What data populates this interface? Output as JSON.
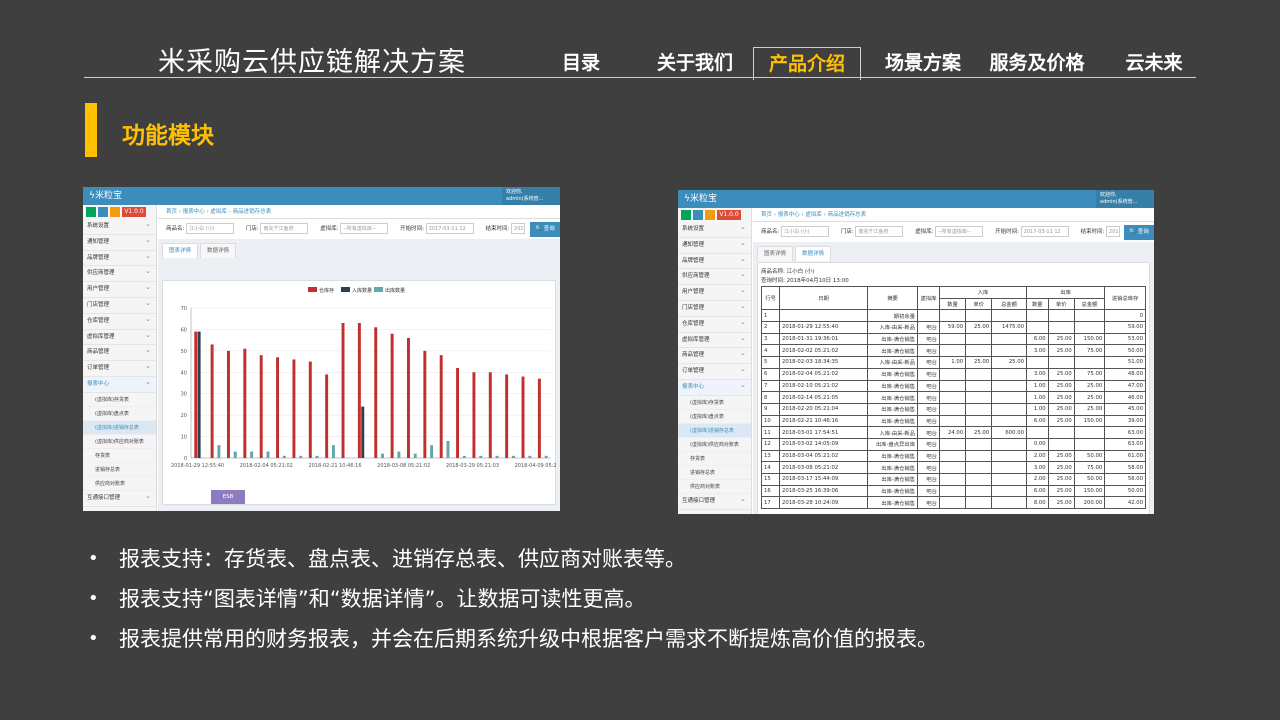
{
  "header": {
    "title": "米采购云供应链解决方案",
    "nav": [
      {
        "label": "目录"
      },
      {
        "label": "关于我们"
      },
      {
        "label": "产品介绍",
        "active": true
      },
      {
        "label": "场景方案"
      },
      {
        "label": "服务及价格"
      },
      {
        "label": "云未来"
      }
    ]
  },
  "section": {
    "title": "功能模块"
  },
  "app": {
    "brand": "米粒宝",
    "version": "V1.0.0",
    "user_line1": "欢迎你,",
    "user_line2": "admin(系统管...",
    "menu": [
      "系统设置",
      "通知管理",
      "品牌管理",
      "供应商管理",
      "用户管理",
      "门店管理",
      "仓库管理",
      "虚拟库管理",
      "商品管理",
      "订单管理",
      "报表中心"
    ],
    "submenu": [
      "(虚拟库)存货表",
      "(虚拟库)盘点表",
      "(虚拟库)进销存总表",
      "(虚拟库)供应商对账表",
      "存货表",
      "进销存总表",
      "供应商对账表"
    ],
    "menu_last": "互通接口管理",
    "breadcrumb": "首页  ›  报表中心  ›  虚拟库  ›  商品进销存总表",
    "filter": {
      "goods_label": "商品名:",
      "goods_value": "江小白 (小)",
      "store_label": "门店:",
      "store_value": "南充千江鱼府",
      "vstore_label": "虚拟库:",
      "vstore_value": "--所有虚拟库--",
      "start_label": "开始时间:",
      "start_value": "2017-03-11 12",
      "end_label": "结束时间:",
      "end_value": "201",
      "query": "查询"
    },
    "tab_chart": "图表详情",
    "tab_data": "数据详情",
    "export": "ESB"
  },
  "chart_data": {
    "type": "bar",
    "legend": [
      "仓库存",
      "入库数量",
      "出库数量"
    ],
    "colors": [
      "#c0302f",
      "#2e3e4e",
      "#62a8ab"
    ],
    "ylim": [
      0,
      70
    ],
    "yticks": [
      0,
      10,
      20,
      30,
      40,
      50,
      60,
      70
    ],
    "xticklabels": [
      "2018-01-29 12:55:40",
      "2018-02-04 05:21:02",
      "2018-02-21 10:46:16",
      "2018-03-08 05:21:02",
      "2018-03-29 05:21:03",
      "2018-04-09 05:21:02"
    ],
    "series": [
      {
        "name": "仓库存",
        "values": [
          59,
          53,
          50,
          51,
          48,
          47,
          46,
          45,
          39,
          63,
          63,
          61,
          58,
          56,
          50,
          48,
          42,
          40,
          40,
          39,
          38,
          37
        ]
      },
      {
        "name": "入库数量",
        "values": [
          59,
          0,
          0,
          0,
          0,
          0,
          0,
          0,
          0,
          0,
          24,
          0,
          0,
          0,
          0,
          0,
          0,
          0,
          0,
          0,
          0,
          0
        ]
      },
      {
        "name": "出库数量",
        "values": [
          0,
          6,
          3,
          3,
          3,
          1,
          1,
          1,
          6,
          0,
          0,
          2,
          3,
          2,
          6,
          8,
          1,
          1,
          1,
          1,
          1,
          1
        ]
      }
    ]
  },
  "datatable": {
    "goods_name": "商品名称:  江小白 (小)",
    "query_time": "查询时间:  2018年04月10日 13:00",
    "headers": {
      "no": "行号",
      "date": "日期",
      "summary": "摘要",
      "vstore": "虚拟库",
      "in": "入库",
      "out": "出库",
      "balance": "进销总库存",
      "qty": "数量",
      "price": "单价",
      "amount": "总金额"
    },
    "rows": [
      [
        "1",
        "",
        "期初余量",
        "",
        "",
        "",
        "",
        "",
        "",
        "",
        "0"
      ],
      [
        "2",
        "2018-01-29 12:55:40",
        "入库-由采-新品",
        "吧台",
        "59.00",
        "25.00",
        "1475.00",
        "",
        "",
        "",
        "59.00"
      ],
      [
        "3",
        "2018-01-31 19:36:01",
        "出库-满仓销售",
        "吧台",
        "",
        "",
        "",
        "6.00",
        "25.00",
        "150.00",
        "53.00"
      ],
      [
        "4",
        "2018-02-02 05:21:02",
        "出库-满仓销售",
        "吧台",
        "",
        "",
        "",
        "3.00",
        "25.00",
        "75.00",
        "50.00"
      ],
      [
        "5",
        "2018-02-03 18:34:35",
        "入库-由采-新品",
        "吧台",
        "1.00",
        "25.00",
        "25.00",
        "",
        "",
        "",
        "51.00"
      ],
      [
        "6",
        "2018-02-04 05:21:02",
        "出库-满仓销售",
        "吧台",
        "",
        "",
        "",
        "3.00",
        "25.00",
        "75.00",
        "48.00"
      ],
      [
        "7",
        "2018-02-10 05:21:02",
        "出库-满仓销售",
        "吧台",
        "",
        "",
        "",
        "1.00",
        "25.00",
        "25.00",
        "47.00"
      ],
      [
        "8",
        "2018-02-14 05:21:05",
        "出库-满仓销售",
        "吧台",
        "",
        "",
        "",
        "1.00",
        "25.00",
        "25.00",
        "46.00"
      ],
      [
        "9",
        "2018-02-20 05:21:04",
        "出库-满仓销售",
        "吧台",
        "",
        "",
        "",
        "1.00",
        "25.00",
        "25.00",
        "45.00"
      ],
      [
        "10",
        "2018-02-21 10:46:16",
        "出库-满仓销售",
        "吧台",
        "",
        "",
        "",
        "6.00",
        "25.00",
        "150.00",
        "39.00"
      ],
      [
        "11",
        "2018-03-01 17:54:51",
        "入库-由采-新品",
        "吧台",
        "24.00",
        "25.00",
        "600.00",
        "",
        "",
        "",
        "63.00"
      ],
      [
        "12",
        "2018-03-02 14:05:09",
        "出库-盘点异出库",
        "吧台",
        "",
        "",
        "",
        "0.00",
        "",
        "",
        "63.00"
      ],
      [
        "13",
        "2018-03-04 05:21:02",
        "出库-满仓销售",
        "吧台",
        "",
        "",
        "",
        "2.00",
        "25.00",
        "50.00",
        "61.00"
      ],
      [
        "14",
        "2018-03-08 05:21:02",
        "出库-满仓销售",
        "吧台",
        "",
        "",
        "",
        "3.00",
        "25.00",
        "75.00",
        "58.00"
      ],
      [
        "15",
        "2018-03-17 15:44:09",
        "出库-满仓销售",
        "吧台",
        "",
        "",
        "",
        "2.00",
        "25.00",
        "50.00",
        "56.00"
      ],
      [
        "16",
        "2018-03-25 16:39:06",
        "出库-满仓销售",
        "吧台",
        "",
        "",
        "",
        "6.00",
        "25.00",
        "150.00",
        "50.00"
      ],
      [
        "17",
        "2018-03-28 10:24:09",
        "出库-满仓销售",
        "吧台",
        "",
        "",
        "",
        "8.00",
        "25.00",
        "200.00",
        "42.00"
      ]
    ]
  },
  "bullets": [
    "报表支持：存货表、盘点表、进销存总表、供应商对账表等。",
    "报表支持“图表详情”和“数据详情”。让数据可读性更高。",
    "报表提供常用的财务报表，并会在后期系统升级中根据客户需求不断提炼高价值的报表。"
  ]
}
